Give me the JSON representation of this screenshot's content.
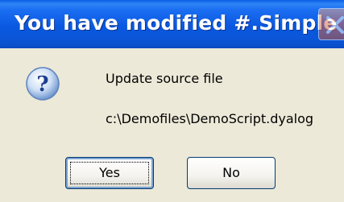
{
  "dialog": {
    "title": "You have modified #.Simple",
    "message": "Update source file",
    "file_path": "c:\\Demofiles\\DemoScript.dyalog",
    "icon": "question-icon"
  },
  "buttons": {
    "yes_label": "Yes",
    "no_label": "No"
  },
  "colors": {
    "titlebar": "#0a58e0",
    "dialog_bg": "#ece9d8",
    "button_border": "#003c74"
  }
}
